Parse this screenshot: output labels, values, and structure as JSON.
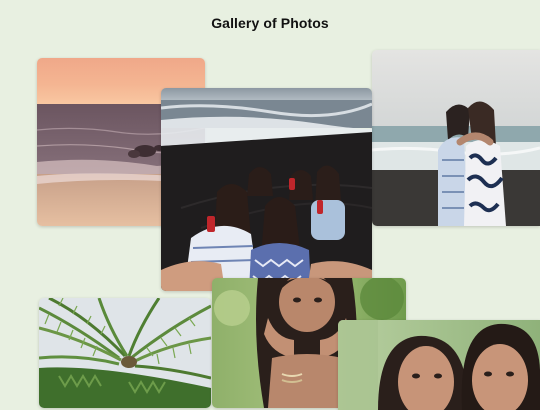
{
  "gallery": {
    "title": "Gallery of Photos"
  },
  "photos": [
    {
      "subject": "sunset-beach"
    },
    {
      "subject": "group-on-beach"
    },
    {
      "subject": "two-girls-hugging"
    },
    {
      "subject": "palm-tree"
    },
    {
      "subject": "girl-hands-on-face"
    },
    {
      "subject": "two-girls-selfie"
    }
  ],
  "colors": {
    "background": "#e8f0e1",
    "title": "#111111"
  }
}
